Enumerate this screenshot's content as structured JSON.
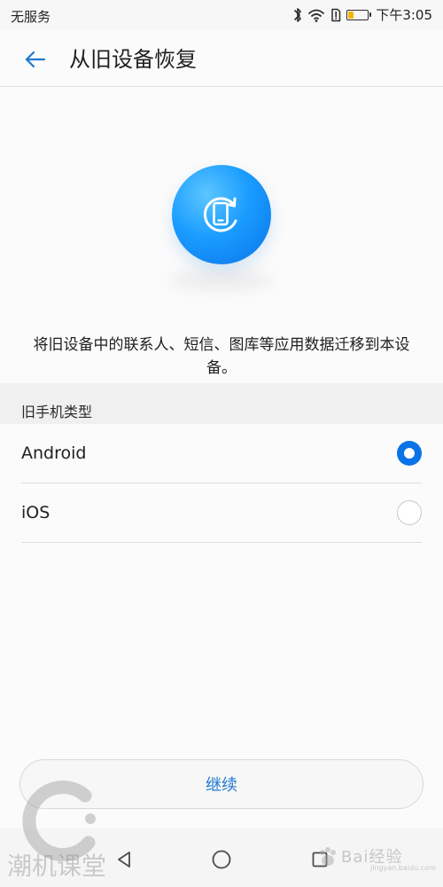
{
  "status_bar": {
    "carrier": "无服务",
    "time": "下午3:05",
    "icons": [
      "bluetooth-icon",
      "wifi-icon",
      "sim-alert-icon",
      "battery-icon"
    ],
    "battery_color": "#f7b500"
  },
  "app_bar": {
    "back_icon": "back-arrow-icon",
    "title": "从旧设备恢复"
  },
  "hero": {
    "icon": "restore-phone-icon",
    "gradient_start": "#5cc6ff",
    "gradient_end": "#0a73e8"
  },
  "description": "将旧设备中的联系人、短信、图库等应用数据迁移到本设备。",
  "section": {
    "title": "旧手机类型"
  },
  "options": [
    {
      "label": "Android",
      "selected": true
    },
    {
      "label": "iOS",
      "selected": false
    }
  ],
  "actions": {
    "continue_label": "继续"
  },
  "navigation": {
    "back_icon": "nav-back-icon",
    "home_icon": "nav-home-icon",
    "recent_icon": "nav-recent-icon"
  },
  "watermarks": {
    "left_text": "潮机课堂",
    "right_text": "Bai经验",
    "right_sub": "jingyan.baidu.com"
  },
  "colors": {
    "accent": "#0a73e8",
    "accent_text": "#1f78d1",
    "background": "#fbfbfb"
  }
}
